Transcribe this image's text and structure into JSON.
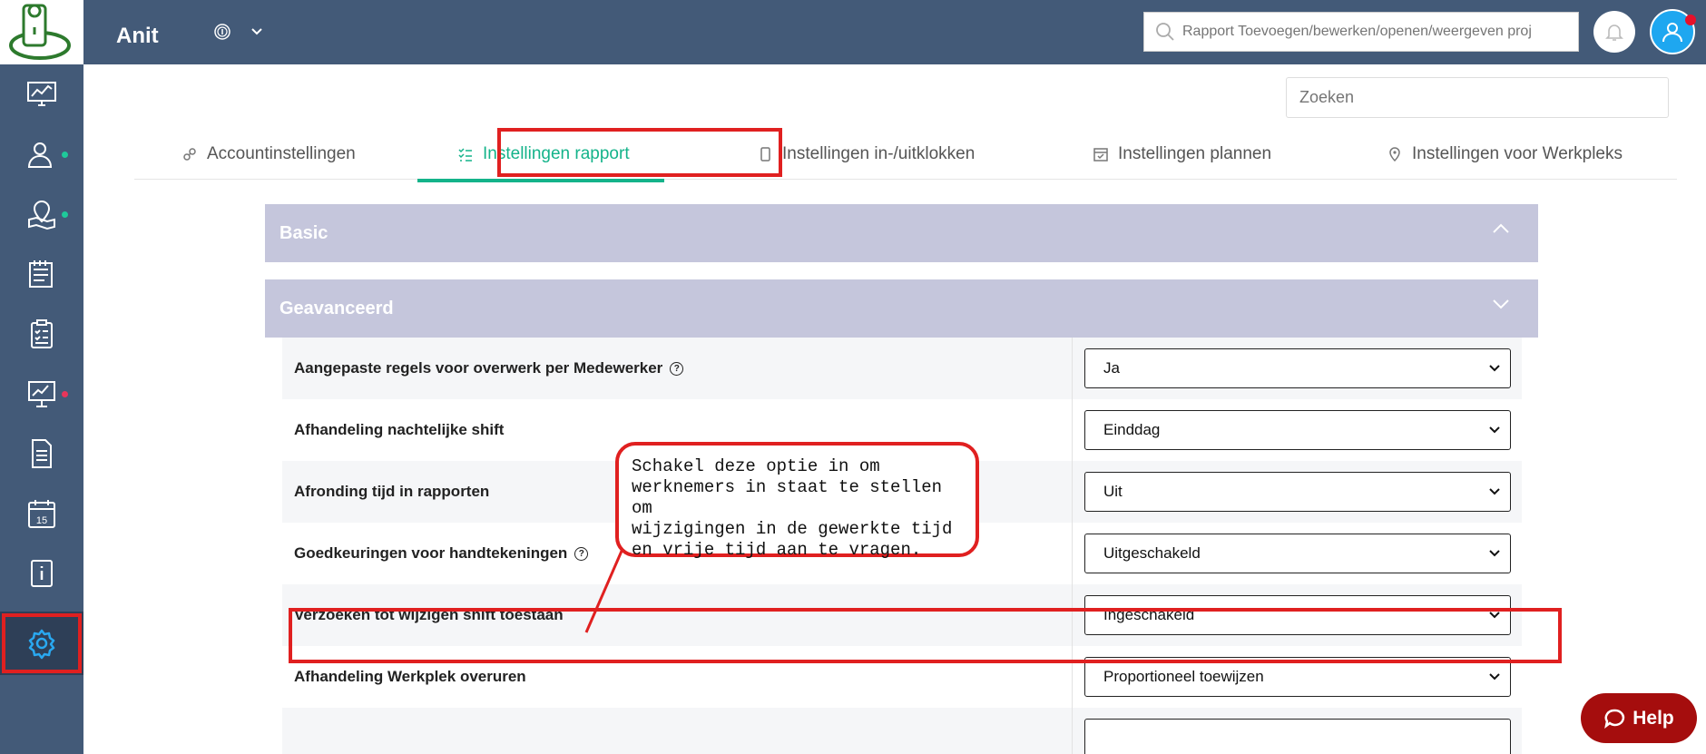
{
  "app": {
    "title": "Anit"
  },
  "header": {
    "search_placeholder": "Rapport Toevoegen/bewerken/openen/weergeven proj"
  },
  "page": {
    "search_placeholder": "Zoeken"
  },
  "tabs": [
    {
      "label": "Accountinstellingen",
      "icon": "link-icon"
    },
    {
      "label": "Instellingen rapport",
      "icon": "checklist-icon",
      "active": true
    },
    {
      "label": "Instellingen in-/uitklokken",
      "icon": "phone-icon"
    },
    {
      "label": "Instellingen plannen",
      "icon": "calendar-check-icon"
    },
    {
      "label": "Instellingen voor Werkpleks",
      "icon": "map-pin-icon"
    }
  ],
  "sections": {
    "basic": "Basic",
    "advanced": "Geavanceerd"
  },
  "settings": [
    {
      "label": "Aangepaste regels voor overwerk per Medewerker",
      "value": "Ja",
      "help": true
    },
    {
      "label": "Afhandeling nachtelijke shift",
      "value": "Einddag"
    },
    {
      "label": "Afronding tijd in rapporten",
      "value": "Uit"
    },
    {
      "label": "Goedkeuringen voor handtekeningen",
      "value": "Uitgeschakeld",
      "help": true
    },
    {
      "label": "Verzoeken tot wijzigen shift toestaan",
      "value": "Ingeschakeld"
    },
    {
      "label": "Afhandeling Werkplek overuren",
      "value": "Proportioneel toewijzen"
    }
  ],
  "callout": {
    "text": "Schakel deze optie in om\nwerknemers in staat te stellen om\nwijzigingen in de gewerkte tijd\nen vrije tijd aan te vragen."
  },
  "help_button": {
    "label": "Help"
  },
  "colors": {
    "sidebar": "#435a78",
    "accent": "#14b38a",
    "highlight": "#e02020",
    "accordion": "#c5c6dc"
  }
}
